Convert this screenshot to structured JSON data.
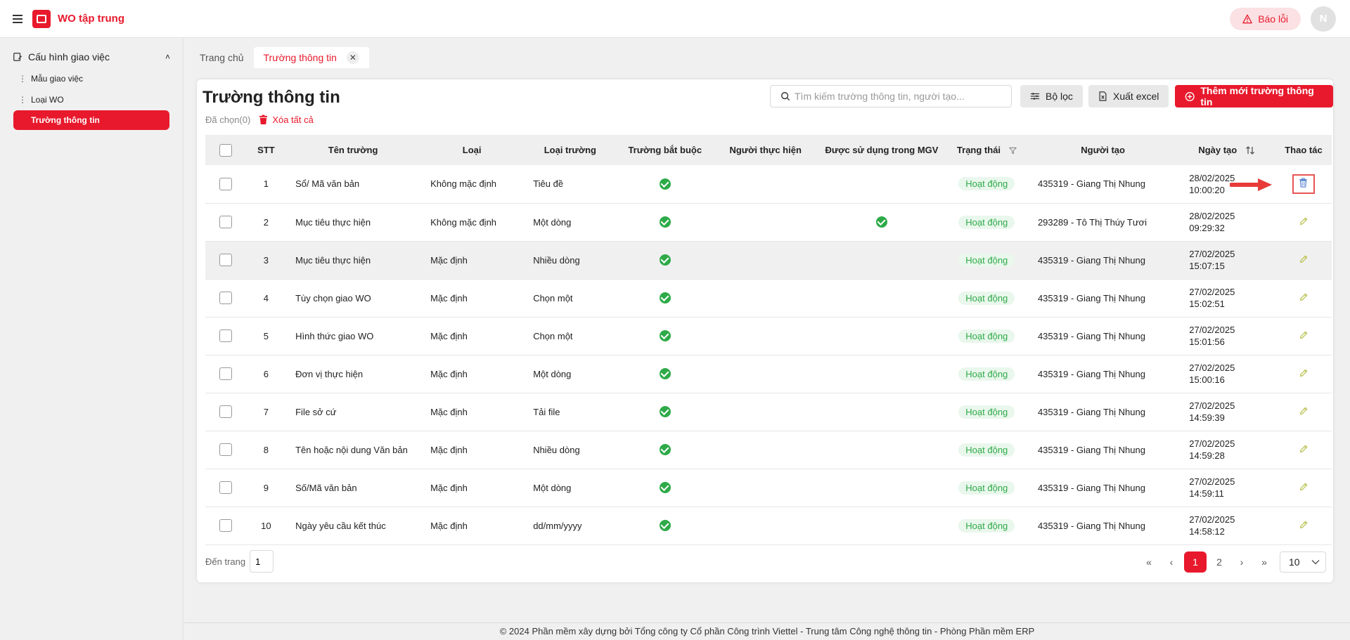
{
  "app": {
    "title": "WO tập trung"
  },
  "header": {
    "bug_label": "Báo lỗi",
    "avatar_initial": "N"
  },
  "sidebar": {
    "group_label": "Cấu hình giao việc",
    "items": [
      {
        "label": "Mẫu giao việc",
        "active": false
      },
      {
        "label": "Loại WO",
        "active": false
      },
      {
        "label": "Trường thông tin",
        "active": true
      }
    ]
  },
  "tabs": [
    {
      "label": "Trang chủ"
    },
    {
      "label": "Trường thông tin"
    }
  ],
  "page": {
    "title": "Trường thông tin",
    "search_placeholder": "Tìm kiếm trường thông tin, người tạo...",
    "filter_label": "Bộ lọc",
    "export_label": "Xuất excel",
    "add_label": "Thêm mới trường thông tin",
    "selected_label": "Đã chọn(0)",
    "delete_all_label": "Xóa tất cả"
  },
  "table": {
    "headers": {
      "stt": "STT",
      "name": "Tên trường",
      "type": "Loại",
      "field_type": "Loại trường",
      "required": "Trường bắt buộc",
      "performer": "Người thực hiện",
      "used_mgv": "Được sử dụng trong MGV",
      "status": "Trạng thái",
      "creator": "Người tạo",
      "created": "Ngày tạo",
      "actions": "Thao tác"
    },
    "rows": [
      {
        "stt": "1",
        "name": "Sổ/ Mã văn bản",
        "type": "Không mặc định",
        "field_type": "Tiêu đề",
        "required": true,
        "performer": "",
        "used_mgv": false,
        "status": "Hoạt động",
        "creator": "435319 - Giang Thị Nhung",
        "date": "28/02/2025",
        "time": "10:00:20"
      },
      {
        "stt": "2",
        "name": "Mục tiêu thực hiện",
        "type": "Không mặc định",
        "field_type": "Một dòng",
        "required": true,
        "performer": "",
        "used_mgv": true,
        "status": "Hoạt động",
        "creator": "293289 - Tô Thị Thúy Tươi",
        "date": "28/02/2025",
        "time": "09:29:32"
      },
      {
        "stt": "3",
        "name": "Mục tiêu thực hiện",
        "type": "Mặc định",
        "field_type": "Nhiều dòng",
        "required": true,
        "performer": "",
        "used_mgv": false,
        "status": "Hoạt động",
        "creator": "435319 - Giang Thị Nhung",
        "date": "27/02/2025",
        "time": "15:07:15"
      },
      {
        "stt": "4",
        "name": "Tùy chọn giao WO",
        "type": "Mặc định",
        "field_type": "Chọn một",
        "required": true,
        "performer": "",
        "used_mgv": false,
        "status": "Hoạt động",
        "creator": "435319 - Giang Thị Nhung",
        "date": "27/02/2025",
        "time": "15:02:51"
      },
      {
        "stt": "5",
        "name": "Hình thức giao WO",
        "type": "Mặc định",
        "field_type": "Chọn một",
        "required": true,
        "performer": "",
        "used_mgv": false,
        "status": "Hoạt động",
        "creator": "435319 - Giang Thị Nhung",
        "date": "27/02/2025",
        "time": "15:01:56"
      },
      {
        "stt": "6",
        "name": "Đơn vị thực hiện",
        "type": "Mặc định",
        "field_type": "Một dòng",
        "required": true,
        "performer": "",
        "used_mgv": false,
        "status": "Hoạt động",
        "creator": "435319 - Giang Thị Nhung",
        "date": "27/02/2025",
        "time": "15:00:16"
      },
      {
        "stt": "7",
        "name": "File sở cứ",
        "type": "Mặc định",
        "field_type": "Tải file",
        "required": true,
        "performer": "",
        "used_mgv": false,
        "status": "Hoạt động",
        "creator": "435319 - Giang Thị Nhung",
        "date": "27/02/2025",
        "time": "14:59:39"
      },
      {
        "stt": "8",
        "name": "Tên hoặc nội dung Văn bản",
        "type": "Mặc định",
        "field_type": "Nhiều dòng",
        "required": true,
        "performer": "",
        "used_mgv": false,
        "status": "Hoạt động",
        "creator": "435319 - Giang Thị Nhung",
        "date": "27/02/2025",
        "time": "14:59:28"
      },
      {
        "stt": "9",
        "name": "Số/Mã văn bản",
        "type": "Mặc định",
        "field_type": "Một dòng",
        "required": true,
        "performer": "",
        "used_mgv": false,
        "status": "Hoạt động",
        "creator": "435319 - Giang Thị Nhung",
        "date": "27/02/2025",
        "time": "14:59:11"
      },
      {
        "stt": "10",
        "name": "Ngày yêu cầu kết thúc",
        "type": "Mặc định",
        "field_type": "dd/mm/yyyy",
        "required": true,
        "performer": "",
        "used_mgv": false,
        "status": "Hoạt động",
        "creator": "435319 - Giang Thị Nhung",
        "date": "27/02/2025",
        "time": "14:58:12"
      }
    ]
  },
  "pagination": {
    "goto_label": "Đến trang",
    "goto_value": "1",
    "pages": [
      "1",
      "2"
    ],
    "current": "1",
    "page_size": "10"
  },
  "footer": {
    "text": "© 2024 Phần mềm xây dựng bởi Tổng công ty Cổ phần Công trình Viettel - Trung tâm Công nghệ thông tin - Phòng Phần mềm ERP"
  },
  "colors": {
    "brand": "#e8192c",
    "success": "#2eaa48",
    "status_bg": "#e9f7ec",
    "annotation": "#e85555"
  }
}
